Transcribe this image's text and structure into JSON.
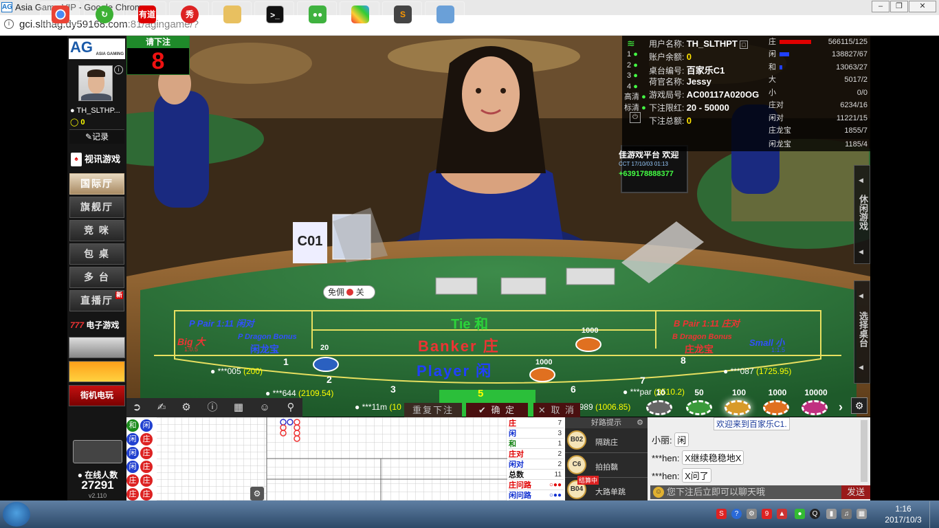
{
  "window": {
    "title": "Asia Game VIP - Google Chrome",
    "app_icon": "AG"
  },
  "address": {
    "url_host": "gci.slthag.dy59168.com",
    "url_rest": ":81/agingame/?"
  },
  "brand": {
    "logo": "AG",
    "logo_sub": "ASIA GAMING"
  },
  "user": {
    "name": "TH_SLTHP...",
    "balance": "0",
    "record_label": "记录"
  },
  "sidebar": {
    "video_games": "视讯游戏",
    "halls": [
      "国际厅",
      "旗舰厅",
      "竞 咪",
      "包 桌",
      "多 台",
      "直播厅"
    ],
    "new_badge": "新",
    "electronic": "电子游戏",
    "arcade": "街机电玩",
    "online_label": "在线人数",
    "online_count": "27291",
    "version": "v2.110"
  },
  "countdown": {
    "label": "请下注",
    "value": "8"
  },
  "info": {
    "username_label": "用户名称:",
    "username": "TH_SLTHPT",
    "balance_label": "账户余额:",
    "balance": "0",
    "table_label": "桌台编号:",
    "table": "百家乐C1",
    "dealer_label": "荷官名称:",
    "dealer": "Jessy",
    "round_label": "游戏局号:",
    "round": "AC00117A020OG",
    "limit_label": "下注限红:",
    "limit": "20 - 50000",
    "total_label": "下注总额:",
    "total": "0",
    "lines": [
      "1",
      "2",
      "3",
      "4"
    ],
    "quality": [
      "高清",
      "标清"
    ]
  },
  "bet_stats": [
    {
      "label": "庄",
      "value": "566115/125",
      "color": "#e00000"
    },
    {
      "label": "闲",
      "value": "138827/67",
      "color": "#2040ff"
    },
    {
      "label": "和",
      "value": "13063/27",
      "color": "#2040ff"
    },
    {
      "label": "大",
      "value": "5017/2",
      "color": ""
    },
    {
      "label": "小",
      "value": "0/0",
      "color": ""
    },
    {
      "label": "庄对",
      "value": "6234/16",
      "color": ""
    },
    {
      "label": "闲对",
      "value": "11221/15",
      "color": ""
    },
    {
      "label": "庄龙宝",
      "value": "1855/7",
      "color": ""
    },
    {
      "label": "闲龙宝",
      "value": "1185/4",
      "color": ""
    }
  ],
  "right_tabs": [
    "休闲游戏",
    "选择桌台"
  ],
  "table": {
    "sign": "C01",
    "free_label": "免佣",
    "free_state": "关",
    "p_pair": "P Pair 1:11 闲对",
    "tie": "Tie 和",
    "b_pair": "B Pair 1:11 庄对",
    "big": "Big 大",
    "big_odds": "1:0.5",
    "p_dragon": "P Dragon Bonus",
    "p_dragon_cn": "闲龙宝",
    "banker": "Banker 庄",
    "b_dragon": "B Dragon Bonus",
    "b_dragon_cn": "庄龙宝",
    "small": "Small 小",
    "small_odds": "1:1.5",
    "player": "Player 闲",
    "chip_amounts": [
      "20",
      "1000",
      "1000"
    ],
    "seats": [
      {
        "num": "1",
        "name": "***005",
        "amount": "(200)"
      },
      {
        "num": "2",
        "name": "***644",
        "amount": "(2109.54)"
      },
      {
        "num": "3",
        "name": "***11m",
        "amount": "(10"
      },
      {
        "num": "5",
        "name": "",
        "amount": ""
      },
      {
        "num": "6",
        "name": "***989",
        "amount": "(1006.85)"
      },
      {
        "num": "7",
        "name": "***par",
        "amount": "(3510.2)"
      },
      {
        "num": "8",
        "name": "***087",
        "amount": "(1725.95)"
      }
    ],
    "screen_line1": "佳游戏平台 欢迎",
    "screen_line2": "CCT 17/10/03 01:13",
    "screen_line3": "+639178888377"
  },
  "chips": [
    "10",
    "50",
    "100",
    "1000",
    "10000"
  ],
  "controls": {
    "repeat": "重复下注",
    "confirm": "确 定",
    "cancel": "取 消"
  },
  "stats": [
    {
      "label": "庄",
      "value": "7",
      "color": "#e00000"
    },
    {
      "label": "闲",
      "value": "3",
      "color": "#1030d0"
    },
    {
      "label": "和",
      "value": "1",
      "color": "#108010"
    },
    {
      "label": "庄对",
      "value": "2",
      "color": "#e00000"
    },
    {
      "label": "闲对",
      "value": "2",
      "color": "#1030d0"
    },
    {
      "label": "总数",
      "value": "11",
      "color": "#111111"
    },
    {
      "label": "庄问路",
      "value": "",
      "color": "#e00000"
    },
    {
      "label": "闲问路",
      "value": "",
      "color": "#1030d0"
    }
  ],
  "hint": {
    "title": "好路提示",
    "rows": [
      {
        "badge": "B02",
        "text": "隔跳庄"
      },
      {
        "badge": "C6",
        "text": "拍拍黐"
      },
      {
        "badge": "B04",
        "text": "大路单跳",
        "tag": "结算中"
      }
    ]
  },
  "chat": {
    "welcome": "欢迎来到百家乐C1.",
    "messages": [
      {
        "user": "小丽:",
        "text": "闲"
      },
      {
        "user": "***hen:",
        "text": "X继续稳稳地X"
      },
      {
        "user": "***hen:",
        "text": "X问了"
      }
    ],
    "placeholder": "您下注后立即可以聊天哦",
    "send": "发送"
  },
  "road_bead": [
    [
      "和",
      "闲"
    ],
    [
      "闲",
      "庄"
    ],
    [
      "闲",
      "庄"
    ],
    [
      "闲",
      "庄"
    ],
    [
      "庄",
      "庄"
    ],
    [
      "庄",
      "庄"
    ],
    [
      "庄",
      ""
    ]
  ],
  "taskbar": {
    "time": "1:16",
    "date": "2017/10/3",
    "apps": [
      "youdao",
      "xiu",
      "explorer",
      "cmd",
      "wechat",
      "slack-like",
      "sublime",
      "photo"
    ],
    "labels": {
      "youdao": "有道",
      "xiu": "秀"
    }
  }
}
